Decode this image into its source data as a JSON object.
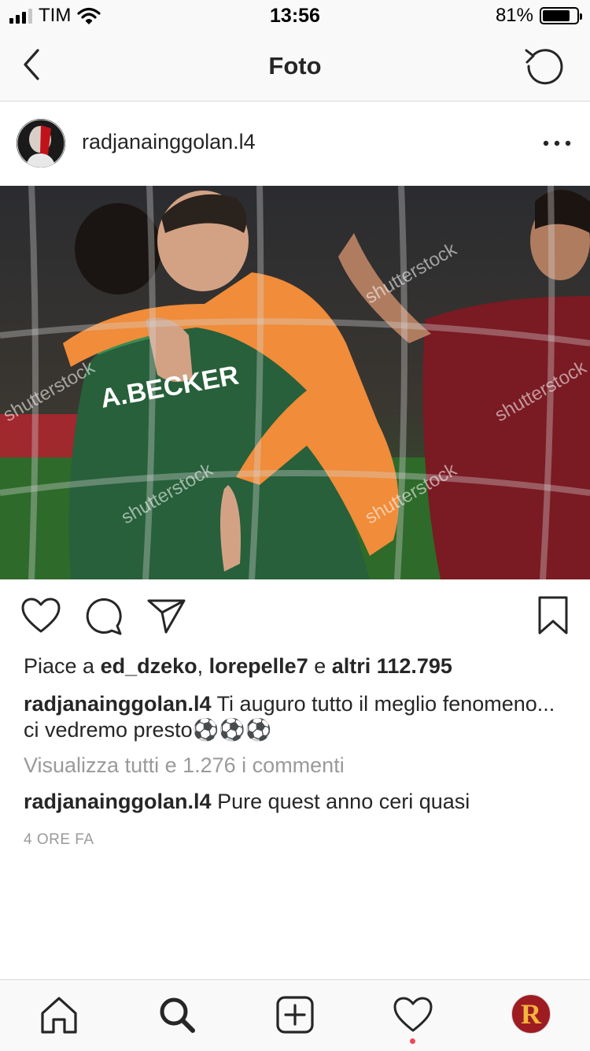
{
  "status_bar": {
    "carrier": "TIM",
    "time": "13:56",
    "battery_percent": "81%",
    "battery_level": 0.81,
    "signal_bars": 3
  },
  "nav": {
    "title": "Foto",
    "back_icon": "chevron-left-icon",
    "right_icon": "refresh-icon"
  },
  "post": {
    "username": "radjanainggolan.l4",
    "more_icon": "ellipsis-icon",
    "photo_watermark": "shutterstock",
    "photo_jersey_text": "A.BECKER"
  },
  "actions": [
    "like-icon",
    "comment-icon",
    "share-icon",
    "bookmark-icon"
  ],
  "likes": {
    "prefix": "Piace a",
    "user1": "ed_dzeko",
    "sep": ",",
    "user2": "lorepelle7",
    "conj": "e",
    "others": "altri 112.795"
  },
  "caption": {
    "username": "radjanainggolan.l4",
    "text": "Ti auguro tutto il meglio fenomeno... ci vedremo presto⚽⚽⚽"
  },
  "view_all_comments": "Visualizza tutti e 1.276 i commenti",
  "comment": {
    "username": "radjanainggolan.l4",
    "text": "Pure quest anno ceri quasi"
  },
  "time_ago": "4 ORE FA",
  "tab_bar": {
    "items": [
      "home-icon",
      "search-icon",
      "add-post-icon",
      "activity-icon",
      "profile-avatar"
    ],
    "profile_letter": "R",
    "notification_color": "#ed4956"
  }
}
